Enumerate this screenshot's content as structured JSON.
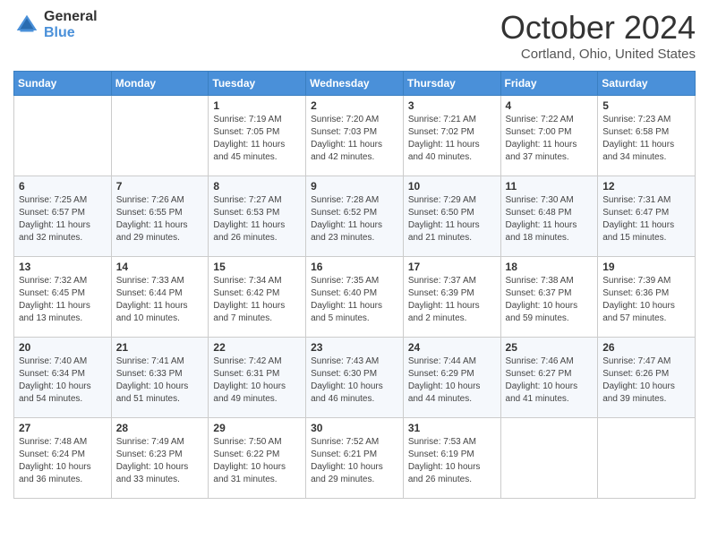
{
  "header": {
    "logo_general": "General",
    "logo_blue": "Blue",
    "month_title": "October 2024",
    "subtitle": "Cortland, Ohio, United States"
  },
  "days_of_week": [
    "Sunday",
    "Monday",
    "Tuesday",
    "Wednesday",
    "Thursday",
    "Friday",
    "Saturday"
  ],
  "weeks": [
    [
      {
        "day": "",
        "info": ""
      },
      {
        "day": "",
        "info": ""
      },
      {
        "day": "1",
        "info": "Sunrise: 7:19 AM\nSunset: 7:05 PM\nDaylight: 11 hours and 45 minutes."
      },
      {
        "day": "2",
        "info": "Sunrise: 7:20 AM\nSunset: 7:03 PM\nDaylight: 11 hours and 42 minutes."
      },
      {
        "day": "3",
        "info": "Sunrise: 7:21 AM\nSunset: 7:02 PM\nDaylight: 11 hours and 40 minutes."
      },
      {
        "day": "4",
        "info": "Sunrise: 7:22 AM\nSunset: 7:00 PM\nDaylight: 11 hours and 37 minutes."
      },
      {
        "day": "5",
        "info": "Sunrise: 7:23 AM\nSunset: 6:58 PM\nDaylight: 11 hours and 34 minutes."
      }
    ],
    [
      {
        "day": "6",
        "info": "Sunrise: 7:25 AM\nSunset: 6:57 PM\nDaylight: 11 hours and 32 minutes."
      },
      {
        "day": "7",
        "info": "Sunrise: 7:26 AM\nSunset: 6:55 PM\nDaylight: 11 hours and 29 minutes."
      },
      {
        "day": "8",
        "info": "Sunrise: 7:27 AM\nSunset: 6:53 PM\nDaylight: 11 hours and 26 minutes."
      },
      {
        "day": "9",
        "info": "Sunrise: 7:28 AM\nSunset: 6:52 PM\nDaylight: 11 hours and 23 minutes."
      },
      {
        "day": "10",
        "info": "Sunrise: 7:29 AM\nSunset: 6:50 PM\nDaylight: 11 hours and 21 minutes."
      },
      {
        "day": "11",
        "info": "Sunrise: 7:30 AM\nSunset: 6:48 PM\nDaylight: 11 hours and 18 minutes."
      },
      {
        "day": "12",
        "info": "Sunrise: 7:31 AM\nSunset: 6:47 PM\nDaylight: 11 hours and 15 minutes."
      }
    ],
    [
      {
        "day": "13",
        "info": "Sunrise: 7:32 AM\nSunset: 6:45 PM\nDaylight: 11 hours and 13 minutes."
      },
      {
        "day": "14",
        "info": "Sunrise: 7:33 AM\nSunset: 6:44 PM\nDaylight: 11 hours and 10 minutes."
      },
      {
        "day": "15",
        "info": "Sunrise: 7:34 AM\nSunset: 6:42 PM\nDaylight: 11 hours and 7 minutes."
      },
      {
        "day": "16",
        "info": "Sunrise: 7:35 AM\nSunset: 6:40 PM\nDaylight: 11 hours and 5 minutes."
      },
      {
        "day": "17",
        "info": "Sunrise: 7:37 AM\nSunset: 6:39 PM\nDaylight: 11 hours and 2 minutes."
      },
      {
        "day": "18",
        "info": "Sunrise: 7:38 AM\nSunset: 6:37 PM\nDaylight: 10 hours and 59 minutes."
      },
      {
        "day": "19",
        "info": "Sunrise: 7:39 AM\nSunset: 6:36 PM\nDaylight: 10 hours and 57 minutes."
      }
    ],
    [
      {
        "day": "20",
        "info": "Sunrise: 7:40 AM\nSunset: 6:34 PM\nDaylight: 10 hours and 54 minutes."
      },
      {
        "day": "21",
        "info": "Sunrise: 7:41 AM\nSunset: 6:33 PM\nDaylight: 10 hours and 51 minutes."
      },
      {
        "day": "22",
        "info": "Sunrise: 7:42 AM\nSunset: 6:31 PM\nDaylight: 10 hours and 49 minutes."
      },
      {
        "day": "23",
        "info": "Sunrise: 7:43 AM\nSunset: 6:30 PM\nDaylight: 10 hours and 46 minutes."
      },
      {
        "day": "24",
        "info": "Sunrise: 7:44 AM\nSunset: 6:29 PM\nDaylight: 10 hours and 44 minutes."
      },
      {
        "day": "25",
        "info": "Sunrise: 7:46 AM\nSunset: 6:27 PM\nDaylight: 10 hours and 41 minutes."
      },
      {
        "day": "26",
        "info": "Sunrise: 7:47 AM\nSunset: 6:26 PM\nDaylight: 10 hours and 39 minutes."
      }
    ],
    [
      {
        "day": "27",
        "info": "Sunrise: 7:48 AM\nSunset: 6:24 PM\nDaylight: 10 hours and 36 minutes."
      },
      {
        "day": "28",
        "info": "Sunrise: 7:49 AM\nSunset: 6:23 PM\nDaylight: 10 hours and 33 minutes."
      },
      {
        "day": "29",
        "info": "Sunrise: 7:50 AM\nSunset: 6:22 PM\nDaylight: 10 hours and 31 minutes."
      },
      {
        "day": "30",
        "info": "Sunrise: 7:52 AM\nSunset: 6:21 PM\nDaylight: 10 hours and 29 minutes."
      },
      {
        "day": "31",
        "info": "Sunrise: 7:53 AM\nSunset: 6:19 PM\nDaylight: 10 hours and 26 minutes."
      },
      {
        "day": "",
        "info": ""
      },
      {
        "day": "",
        "info": ""
      }
    ]
  ]
}
